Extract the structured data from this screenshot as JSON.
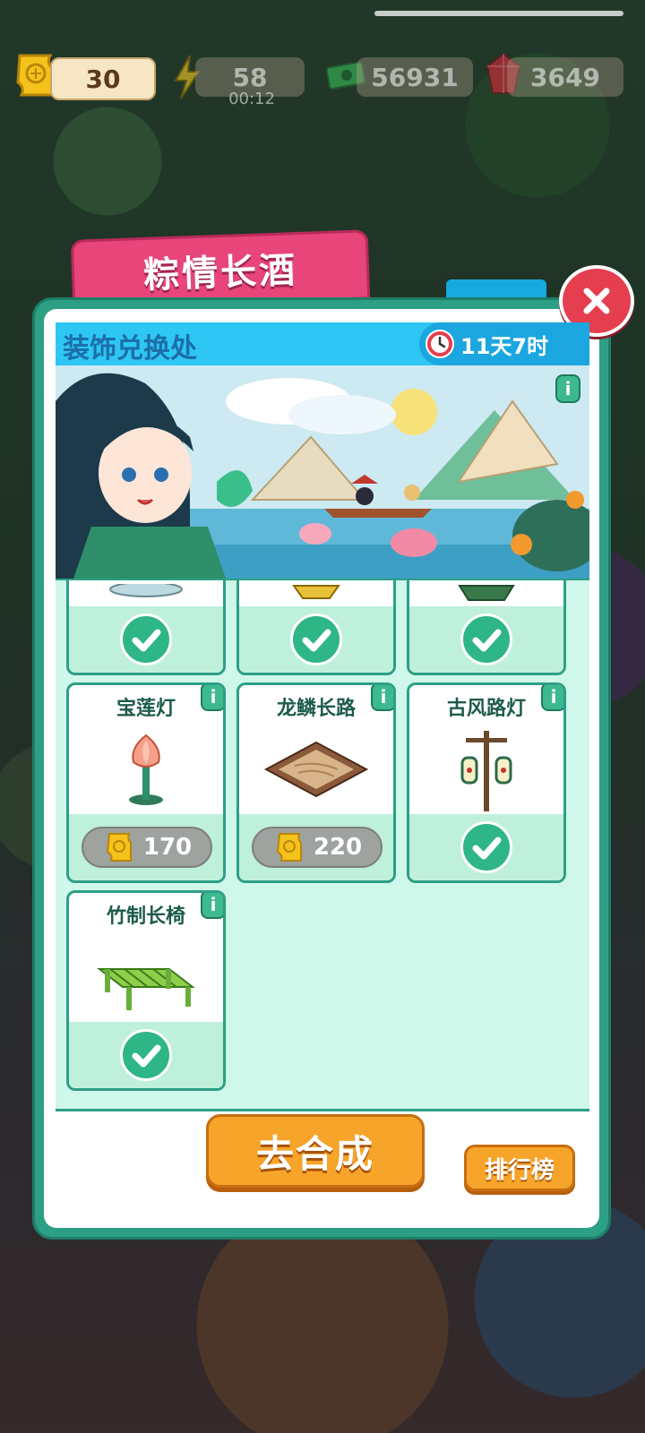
{
  "resources": {
    "tickets": "30",
    "energy": "58",
    "energy_timer": "00:12",
    "cash": "56931",
    "gems": "3649"
  },
  "event": {
    "title": "粽情长酒",
    "shop_title": "装饰兑换处",
    "countdown": "11天7时"
  },
  "items": [
    {
      "name": "",
      "status": "owned"
    },
    {
      "name": "",
      "status": "owned"
    },
    {
      "name": "",
      "status": "owned"
    },
    {
      "name": "宝莲灯",
      "status": "price",
      "price": "170"
    },
    {
      "name": "龙鳞长路",
      "status": "price",
      "price": "220"
    },
    {
      "name": "古风路灯",
      "status": "owned"
    },
    {
      "name": "竹制长椅",
      "status": "owned"
    }
  ],
  "buttons": {
    "go_merge": "去合成",
    "leaderboard": "排行榜"
  },
  "icons": {
    "ticket": "golden-ticket-icon",
    "energy": "lightning-icon",
    "cash": "cash-icon",
    "gem": "ruby-icon",
    "close": "close-icon",
    "clock": "clock-icon",
    "info": "info-icon",
    "check": "check-icon"
  },
  "colors": {
    "panel": "#2d9f85",
    "tab": "#e8457a",
    "header": "#2ec6f4",
    "button": "#f7a42a",
    "check": "#2eb686"
  }
}
